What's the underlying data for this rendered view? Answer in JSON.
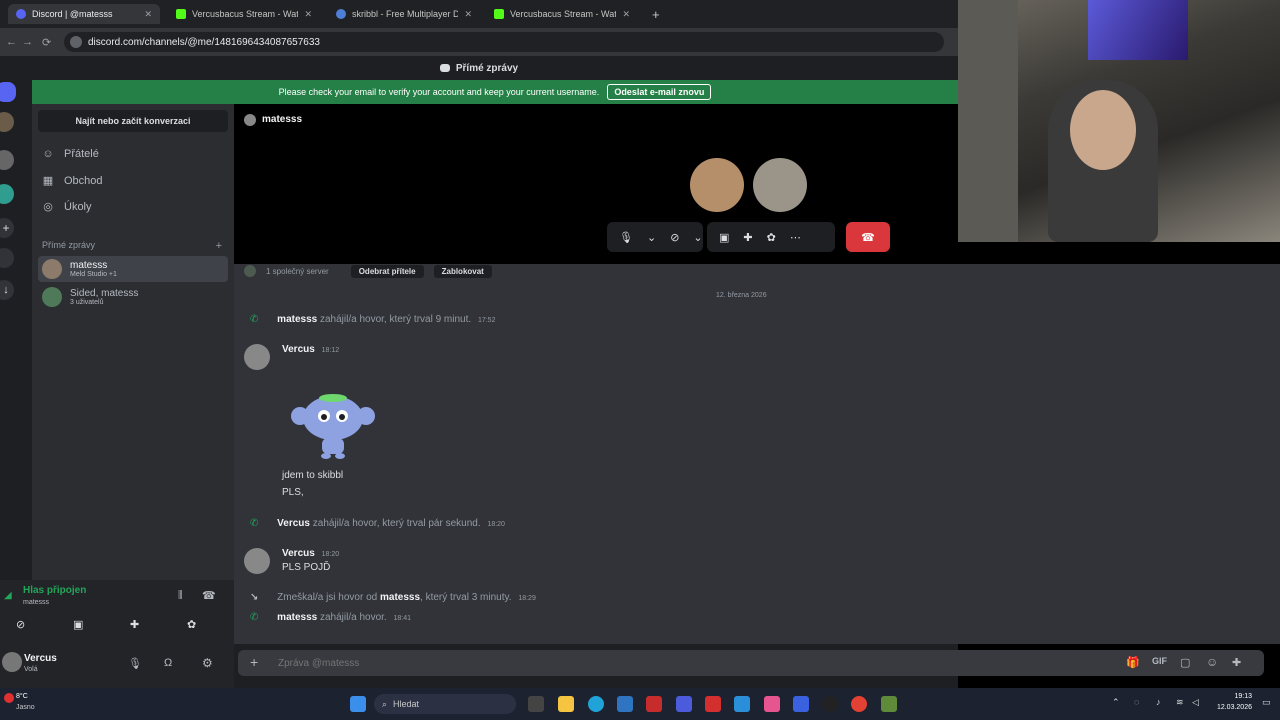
{
  "browser": {
    "tabs": [
      {
        "label": "Discord | @matesss",
        "active": true
      },
      {
        "label": "Vercusbacus Stream - Watch Li",
        "active": false
      },
      {
        "label": "skribbl - Free Multiplayer Draw",
        "active": false
      },
      {
        "label": "Vercusbacus Stream - Watch Li",
        "active": false
      }
    ],
    "url": "discord.com/channels/@me/1481696434087657633"
  },
  "discord": {
    "topbar_title": "Přímé zprávy",
    "banner": {
      "text": "Please check your email to verify your account and keep your current username.",
      "button": "Odeslat e-mail znovu"
    },
    "search_placeholder": "Najít nebo začít konverzaci",
    "nav": [
      {
        "label": "Přátelé",
        "icon": "friends-icon"
      },
      {
        "label": "Obchod",
        "icon": "shop-icon"
      },
      {
        "label": "Úkoly",
        "icon": "quests-icon"
      }
    ],
    "dm_header": "Přímé zprávy",
    "dms": [
      {
        "name": "matesss",
        "sub": "Meld Studio +1"
      },
      {
        "name": "Sided, matesss",
        "sub": "3 uživatelů"
      }
    ],
    "voice": {
      "status": "Hlas připojen",
      "channel": "matesss"
    },
    "user": {
      "name": "Vercus",
      "status": "Volá"
    },
    "call_title": "matesss",
    "profile_bar": {
      "mutual": "1 společný server",
      "remove": "Odebrat přítele",
      "block": "Zablokovat"
    },
    "date_divider": "12. března 2026",
    "messages": [
      {
        "type": "call",
        "author": "matesss",
        "text": "zahájil/a hovor, který trval 9 minut.",
        "time": "17:52"
      },
      {
        "type": "msg",
        "author": "Vercus",
        "time": "18:12",
        "lines": [
          "jdem to skibbl",
          "PLS,"
        ]
      },
      {
        "type": "call",
        "author": "Vercus",
        "text": "zahájil/a hovor, který trval pár sekund.",
        "time": "18:20"
      },
      {
        "type": "msg",
        "author": "Vercus",
        "time": "18:20",
        "lines": [
          "PLS POJĎ"
        ]
      },
      {
        "type": "missed",
        "prefix": "Zmeškal/a jsi hovor od",
        "author": "matesss",
        "text": ", který trval 3 minuty.",
        "time": "18:29"
      },
      {
        "type": "call",
        "author": "matesss",
        "text": "zahájil/a hovor.",
        "time": "18:41"
      }
    ],
    "composer_placeholder": "Zpráva @matesss"
  },
  "taskbar": {
    "weather_temp": "8°C",
    "weather_text": "Jasno",
    "search": "Hledat",
    "time": "19:13",
    "date": "12.03.2026"
  },
  "colors": {
    "accent_green": "#23a55a",
    "banner": "#248046",
    "hangup": "#da373c",
    "discord_blurple": "#5865f2"
  }
}
